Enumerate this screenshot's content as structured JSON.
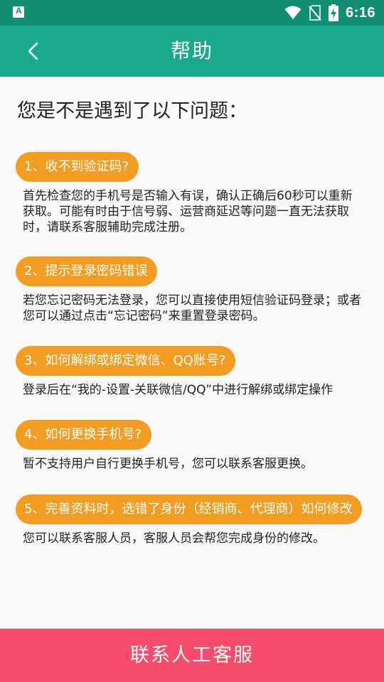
{
  "status_bar": {
    "time": "6:16",
    "icons": [
      "notification-a-icon",
      "wifi-icon",
      "no-sim-icon",
      "battery-charging-icon"
    ]
  },
  "app_bar": {
    "title": "帮助",
    "back_icon": "chevron-left-icon"
  },
  "colors": {
    "status_bar": "#128e74",
    "app_bar": "#1aa98a",
    "pill": "#f29d22",
    "bottom_button": "#f54c6b"
  },
  "heading": "您是不是遇到了以下问题：",
  "faqs": [
    {
      "question": "1、收不到验证码?",
      "answer": "首先检查您的手机号是否输入有误，确认正确后60秒可以重新获取。可能有时由于信号弱、运营商延迟等问题一直无法获取时，请联系客服辅助完成注册。"
    },
    {
      "question": "2、提示登录密码错误",
      "answer": "若您忘记密码无法登录，您可以直接使用短信验证码登录；或者您可以通过点击“忘记密码”来重置登录密码。"
    },
    {
      "question": "3、如何解绑或绑定微信、QQ账号?",
      "answer": "登录后在“我的-设置-关联微信/QQ”中进行解绑或绑定操作"
    },
    {
      "question": "4、如何更换手机号?",
      "answer": "暂不支持用户自行更换手机号，您可以联系客服更换。"
    },
    {
      "question": "5、完善资料时，选错了身份（经销商、代理商）如何修改",
      "answer": "您可以联系客服人员，客服人员会帮您完成身份的修改。"
    }
  ],
  "bottom_button": "联系人工客服"
}
